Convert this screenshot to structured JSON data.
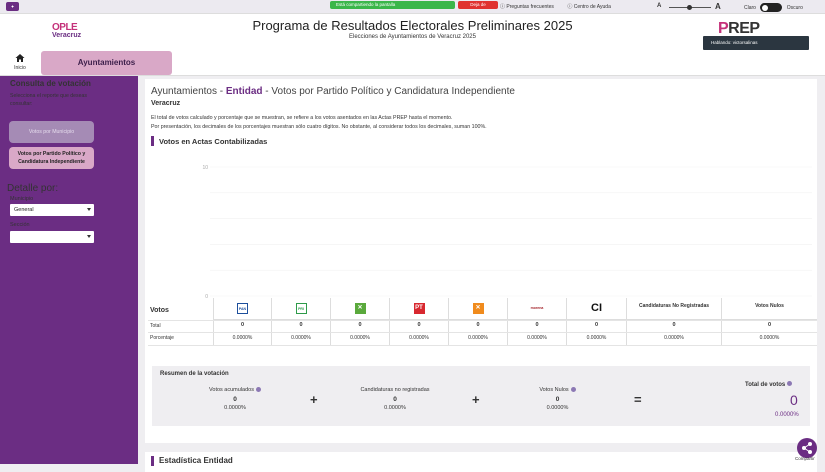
{
  "topbar": {
    "share_notice": "Está compartiendo la pantalla",
    "stop_share": "Deja de",
    "link_faq": "Preguntas frecuentes",
    "link_help": "Centro de Ayuda",
    "font_small": "A",
    "font_large": "A",
    "theme_light": "Claro",
    "theme_dark": "Oscuro"
  },
  "header": {
    "logo_top": "OPLE",
    "logo_bottom": "Veracruz",
    "title": "Programa de Resultados Electorales Preliminares 2025",
    "subtitle": "Elecciones de Ayuntamientos de Veracruz 2025",
    "prep_logo_a": "P",
    "prep_logo_b": "REP",
    "tooltip": "Hablando: victorsalinas"
  },
  "nav": {
    "home_label": "Inicio",
    "tab_active": "Ayuntamientos"
  },
  "sidebar": {
    "heading": "Consulta de votación",
    "description": "Selecciona el reporte que deseas consultar:",
    "btn_municipio": "Votos por Municipio",
    "btn_partido_l1": "Votos por Partido Político y",
    "btn_partido_l2": "Candidatura Independiente",
    "detail_heading": "Detalle por:",
    "municipio_label": "Municipio",
    "municipio_value": "General",
    "seccion_label": "Sección",
    "seccion_value": ""
  },
  "main": {
    "title_prefix": "Ayuntamientos - ",
    "title_entity": "Entidad",
    "title_suffix": " - Votos por Partido Político y Candidatura Independiente",
    "region": "Veracruz",
    "note_line1": "El total de votos calculado y porcentaje que se muestran, se refiere a los votos asentados en las Actas PREP hasta el momento.",
    "note_line2": "Por presentación, los decimales de los porcentajes muestran sólo cuatro dígitos. No obstante, al considerar todos los decimales, suman 100%.",
    "section_votos": "Votos en Actas Contabilizadas",
    "votos_label": "Votos",
    "total_label": "Total",
    "pct_label": "Porcentaje",
    "section_estadistica": "Estadística Entidad",
    "share_label": "Compartir"
  },
  "chart_data": {
    "type": "bar",
    "categories": [
      "PAN",
      "PRI",
      "PVEM",
      "PT",
      "MC",
      "MORENA",
      "CI",
      "Candidaturas No Registradas",
      "Votos Nulos"
    ],
    "values": [
      0,
      0,
      0,
      0,
      0,
      0,
      0,
      0,
      0
    ],
    "yticks": [
      "10",
      "",
      "",
      "",
      "",
      "0"
    ],
    "ylim": [
      0,
      10
    ],
    "grid": true
  },
  "table": {
    "columns": [
      {
        "name": "PAN",
        "logo": "PAN",
        "color": "#1d4f9c",
        "total": "0",
        "pct": "0.0000%"
      },
      {
        "name": "PRI",
        "logo": "PRI",
        "color": "#2e9b4a",
        "total": "0",
        "pct": "0.0000%"
      },
      {
        "name": "PVEM",
        "logo": "✕",
        "color": "#5aa93c",
        "total": "0",
        "pct": "0.0000%"
      },
      {
        "name": "PT",
        "logo": "PT",
        "color": "#d8282f",
        "total": "0",
        "pct": "0.0000%"
      },
      {
        "name": "MC",
        "logo": "✕",
        "color": "#f08b1d",
        "total": "0",
        "pct": "0.0000%"
      },
      {
        "name": "MORENA",
        "logo": "morena",
        "color": "#a5252c",
        "total": "0",
        "pct": "0.0000%"
      },
      {
        "name": "CI",
        "logo": "CI",
        "color": "#111111",
        "total": "0",
        "pct": "0.0000%"
      },
      {
        "name": "Candidaturas No Registradas",
        "logo": "",
        "color": "",
        "total": "0",
        "pct": "0.0000%"
      },
      {
        "name": "Votos Nulos",
        "logo": "",
        "color": "",
        "total": "0",
        "pct": "0.0000%"
      }
    ]
  },
  "resumen": {
    "title": "Resumen de la votación",
    "acumulados_label": "Votos acumulados",
    "acumulados_n": "0",
    "acumulados_p": "0.0000%",
    "no_reg_label": "Candidaturas no registradas",
    "no_reg_n": "0",
    "no_reg_p": "0.0000%",
    "nulos_label": "Votos Nulos",
    "nulos_n": "0",
    "nulos_p": "0.0000%",
    "plus": "+",
    "equals": "=",
    "total_label": "Total de votos",
    "total_n": "0",
    "total_p": "0.0000%"
  }
}
